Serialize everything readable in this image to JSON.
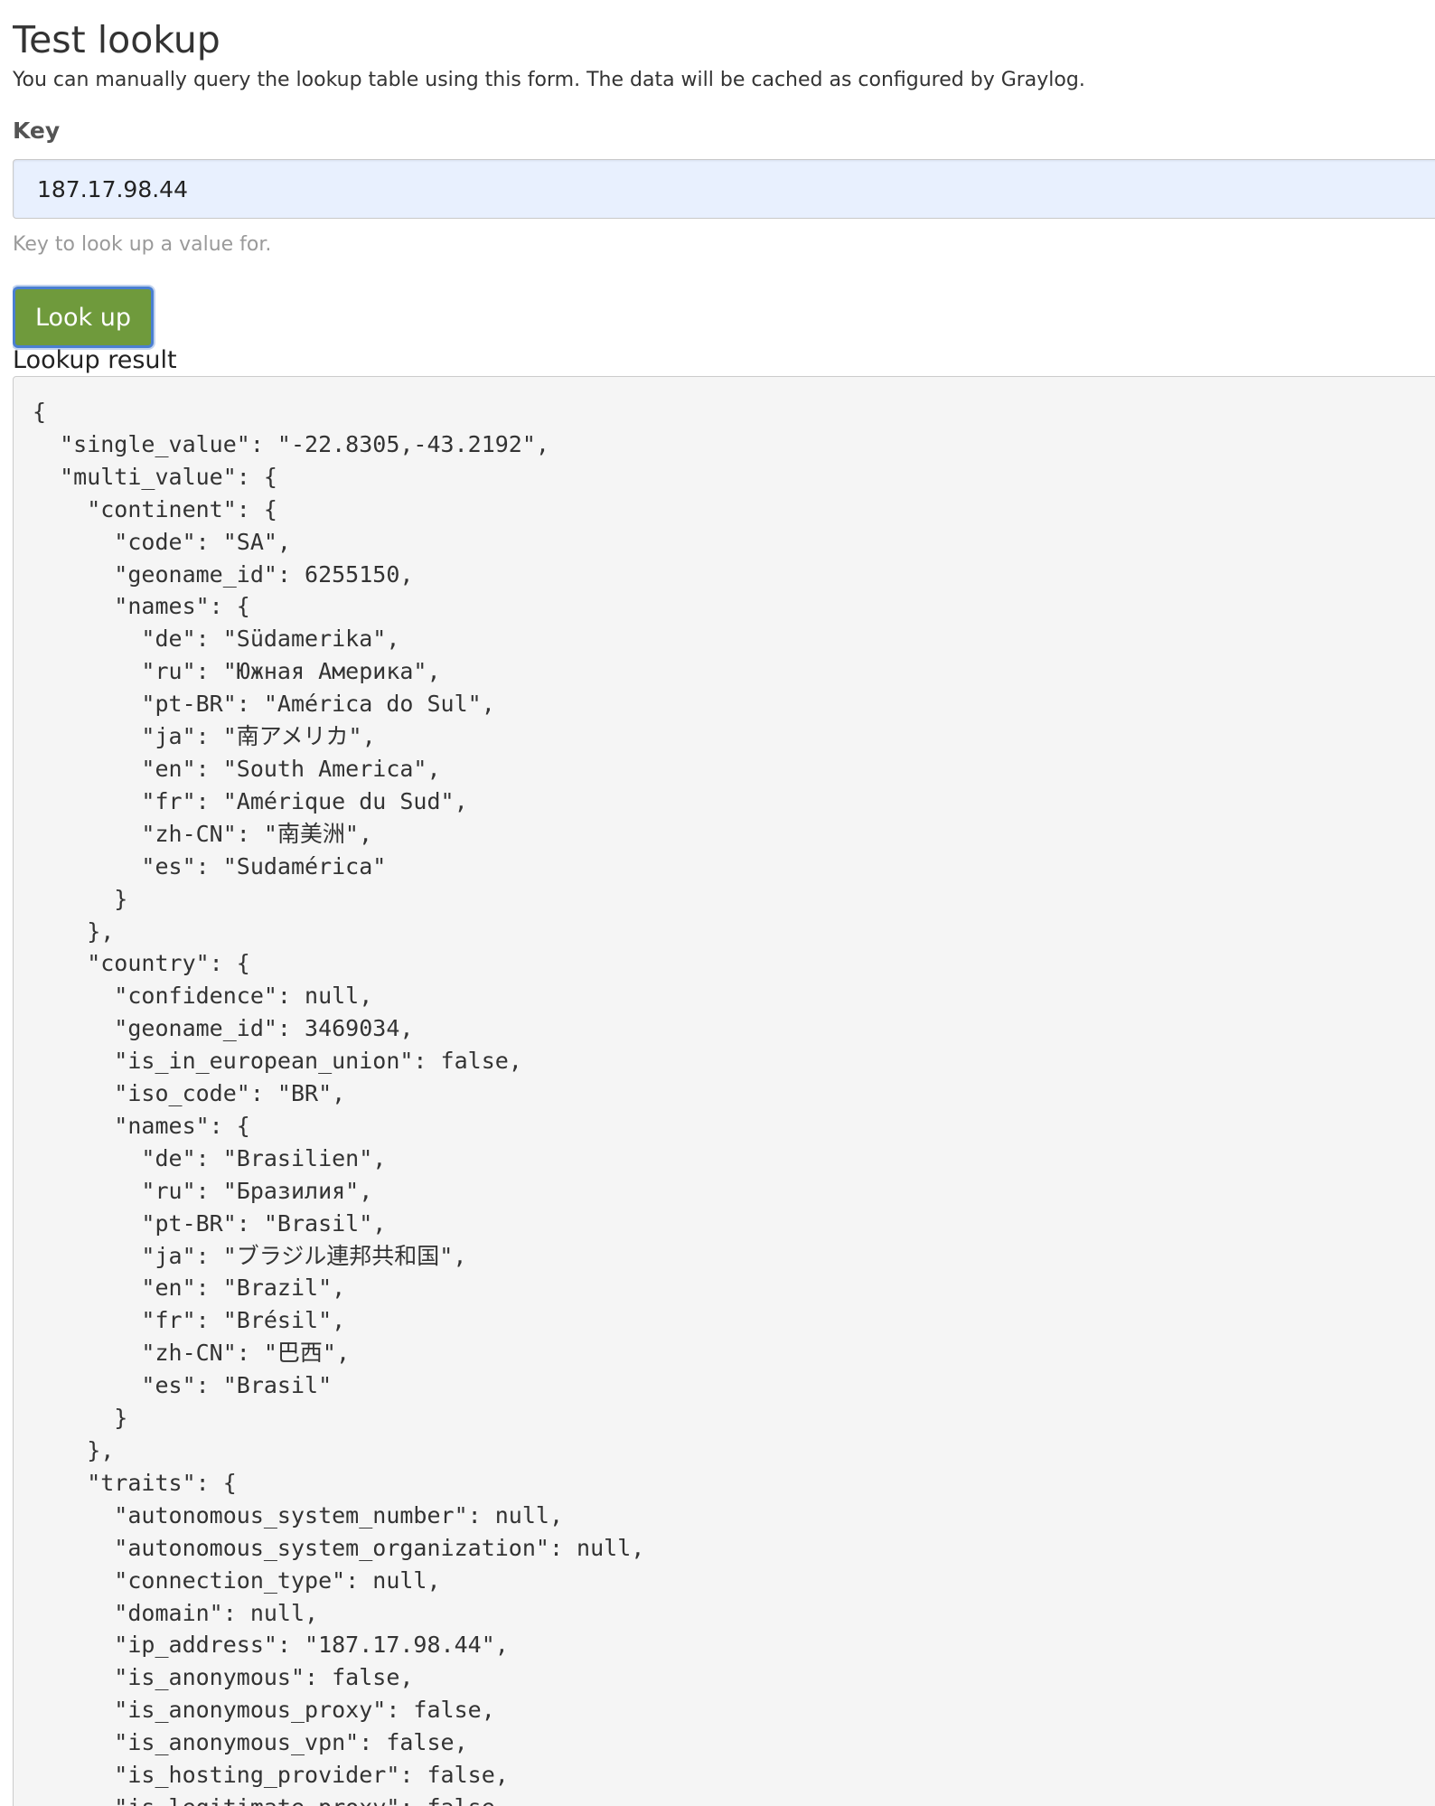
{
  "page": {
    "title": "Test lookup",
    "description": "You can manually query the lookup table using this form. The data will be cached as configured by Graylog."
  },
  "form": {
    "key_label": "Key",
    "key_value": "187.17.98.44",
    "key_help": "Key to look up a value for.",
    "submit_label": "Look up"
  },
  "result": {
    "label": "Lookup result",
    "json_text": "{\n  \"single_value\": \"-22.8305,-43.2192\",\n  \"multi_value\": {\n    \"continent\": {\n      \"code\": \"SA\",\n      \"geoname_id\": 6255150,\n      \"names\": {\n        \"de\": \"Südamerika\",\n        \"ru\": \"Южная Америка\",\n        \"pt-BR\": \"América do Sul\",\n        \"ja\": \"南アメリカ\",\n        \"en\": \"South America\",\n        \"fr\": \"Amérique du Sud\",\n        \"zh-CN\": \"南美洲\",\n        \"es\": \"Sudamérica\"\n      }\n    },\n    \"country\": {\n      \"confidence\": null,\n      \"geoname_id\": 3469034,\n      \"is_in_european_union\": false,\n      \"iso_code\": \"BR\",\n      \"names\": {\n        \"de\": \"Brasilien\",\n        \"ru\": \"Бразилия\",\n        \"pt-BR\": \"Brasil\",\n        \"ja\": \"ブラジル連邦共和国\",\n        \"en\": \"Brazil\",\n        \"fr\": \"Brésil\",\n        \"zh-CN\": \"巴西\",\n        \"es\": \"Brasil\"\n      }\n    },\n    \"traits\": {\n      \"autonomous_system_number\": null,\n      \"autonomous_system_organization\": null,\n      \"connection_type\": null,\n      \"domain\": null,\n      \"ip_address\": \"187.17.98.44\",\n      \"is_anonymous\": false,\n      \"is_anonymous_proxy\": false,\n      \"is_anonymous_vpn\": false,\n      \"is_hosting_provider\": false,\n      \"is_legitimate_proxy\": false,"
  },
  "colors": {
    "button_bg": "#6f9a3c",
    "button_focus_border": "#4a7fd1",
    "input_bg": "#e8f0fe",
    "code_bg": "#f5f5f5"
  }
}
